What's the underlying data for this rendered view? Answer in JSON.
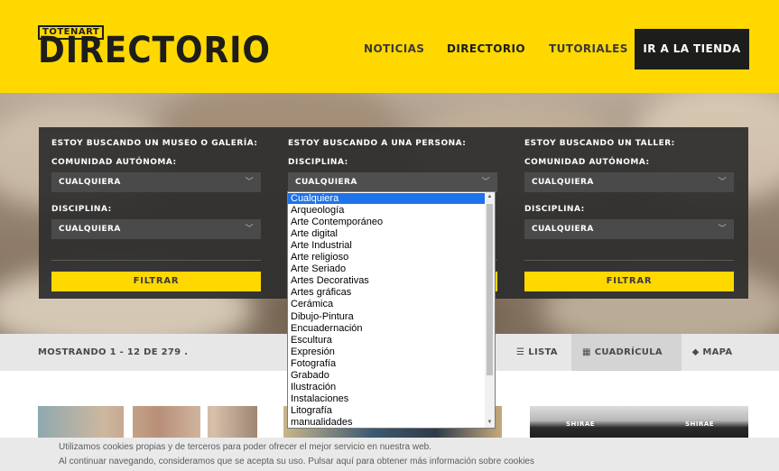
{
  "header": {
    "logo_badge": "TOTENART",
    "logo_text": "DIRECTORIO",
    "nav": {
      "noticias": "NOTICIAS",
      "directorio": "DIRECTORIO",
      "tutoriales": "TUTORIALES",
      "tienda": "IR A LA TIENDA"
    }
  },
  "search": {
    "col1": {
      "title": "ESTOY BUSCANDO UN MUSEO O GALERÍA:",
      "label1": "COMUNIDAD AUTÓNOMA:",
      "value1": "CUALQUIERA",
      "label2": "DISCIPLINA:",
      "value2": "CUALQUIERA",
      "button": "FILTRAR"
    },
    "col2": {
      "title": "ESTOY BUSCANDO A UNA PERSONA:",
      "label1": "DISCIPLINA:",
      "value1": "CUALQUIERA"
    },
    "col3": {
      "title": "ESTOY BUSCANDO UN TALLER:",
      "label1": "COMUNIDAD AUTÓNOMA:",
      "value1": "CUALQUIERA",
      "label2": "DISCIPLINA:",
      "value2": "CUALQUIERA",
      "button": "FILTRAR"
    }
  },
  "dropdown": {
    "items": [
      "Cualquiera",
      "Arqueología",
      "Arte Contemporáneo",
      "Arte digital",
      "Arte Industrial",
      "Arte religioso",
      "Arte Seriado",
      "Artes Decorativas",
      "Artes gráficas",
      "Cerámica",
      "Dibujo-Pintura",
      "Encuadernación",
      "Escultura",
      "Expresión",
      "Fotografía",
      "Grabado",
      "Ilustración",
      "Instalaciones",
      "Litografía",
      "manualidades"
    ],
    "selected_index": 0
  },
  "results": {
    "count": "MOSTRANDO 1 - 12 DE 279 .",
    "views": {
      "lista": "LISTA",
      "cuadricula": "CUADRÍCULA",
      "mapa": "MAPA"
    },
    "active_view": "cuadricula"
  },
  "cards": {
    "card3_sign_left": "SHIRAE",
    "card3_sign_right": "SHIRAE"
  },
  "cookie": {
    "line1": "Utilizamos cookies propias y de terceros para poder ofrecer el mejor servicio en nuestra web.",
    "line2": "Al continuar navegando, consideramos que se acepta su uso. Pulsar aquí para obtener más información sobre cookies"
  },
  "colors": {
    "brand_yellow": "#ffd800",
    "panel_dark": "#2d2d2d",
    "selected_blue": "#1e73e8"
  },
  "icons": [
    "list-icon",
    "grid-icon",
    "map-pin-icon",
    "chevron-down-icon",
    "scroll-up-arrow-icon",
    "scroll-down-arrow-icon"
  ]
}
